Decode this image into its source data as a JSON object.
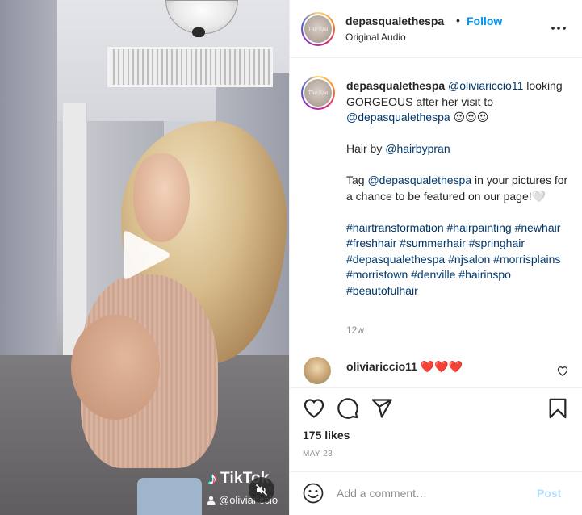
{
  "post": {
    "username": "depasqualethespa",
    "avatar_text": "The Spa",
    "separator": "•",
    "follow_label": "Follow",
    "audio": "Original Audio"
  },
  "caption": {
    "username": "depasqualethespa",
    "mention_1": "@oliviariccio11",
    "line_1_rest": "looking GORGEOUS after her visit to",
    "mention_2": "@depasqualethespa",
    "emojis_1": "😍😍😍",
    "hair_by": "Hair by",
    "mention_3": "@hairbypran",
    "tag_prefix": "Tag",
    "mention_4": "@depasqualethespa",
    "tag_rest": "in your pictures for a chance to be featured on our page!🤍",
    "hashtags": [
      "#hairtransformation",
      "#hairpainting",
      "#newhair",
      "#freshhair",
      "#summerhair",
      "#springhair",
      "#depasqualethespa",
      "#njsalon",
      "#morrisplains",
      "#morristown",
      "#denville",
      "#hairinspo",
      "#beautofulhair"
    ],
    "time": "12w"
  },
  "comment": {
    "username": "oliviariccio11",
    "text": "❤️❤️❤️"
  },
  "actions": {
    "likes": "175 likes",
    "date": "MAY 23"
  },
  "add_comment": {
    "placeholder": "Add a comment…",
    "post_label": "Post"
  },
  "media": {
    "watermark_logo": "TikTok",
    "watermark_user": "@oliviariccio"
  },
  "colors": {
    "accent_blue": "#0095f6",
    "link_blue": "#00376b",
    "post_disabled": "#b2dffc",
    "muted_gray": "#8e8e8e",
    "heart_red": "#ed4956"
  }
}
